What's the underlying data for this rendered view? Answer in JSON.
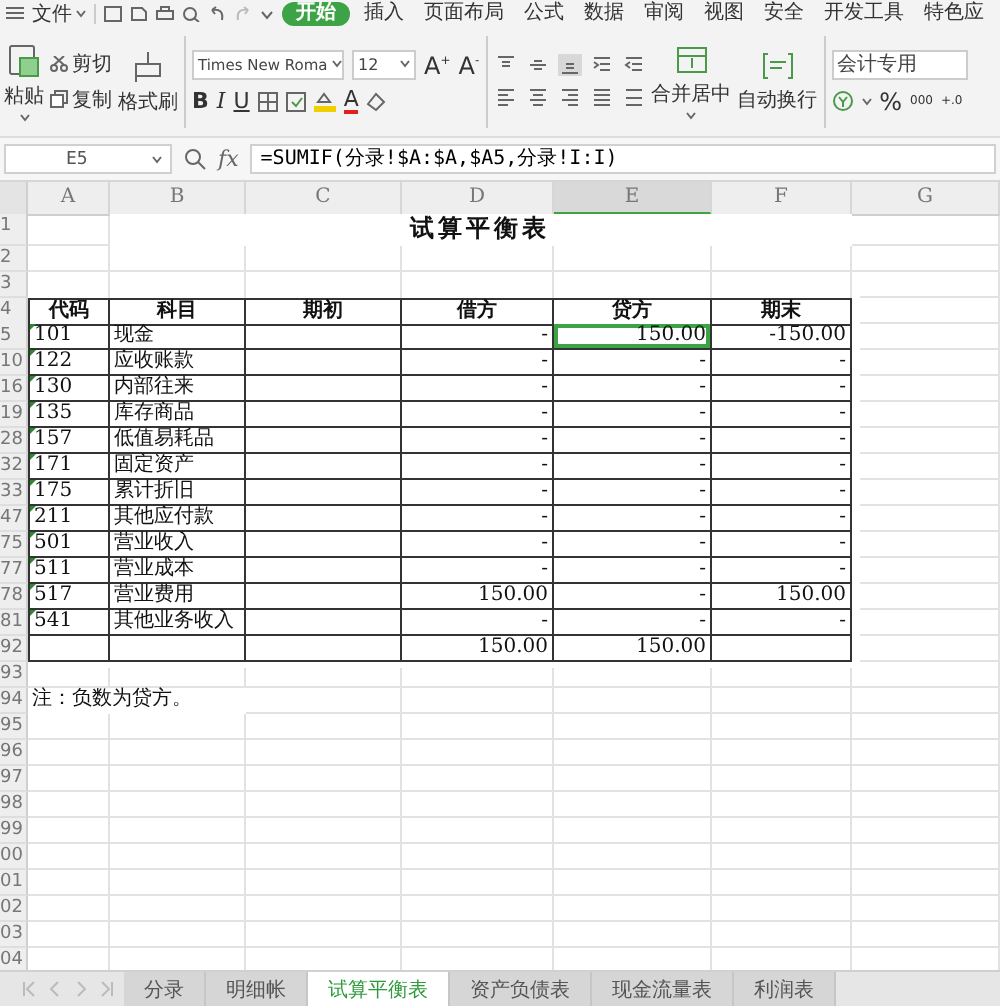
{
  "menu": {
    "file": "文件",
    "tabs": [
      {
        "label": "开始",
        "selected": true
      },
      {
        "label": "插入",
        "selected": false
      },
      {
        "label": "页面布局",
        "selected": false
      },
      {
        "label": "公式",
        "selected": false
      },
      {
        "label": "数据",
        "selected": false
      },
      {
        "label": "审阅",
        "selected": false
      },
      {
        "label": "视图",
        "selected": false
      },
      {
        "label": "安全",
        "selected": false
      },
      {
        "label": "开发工具",
        "selected": false
      },
      {
        "label": "特色应",
        "selected": false
      }
    ]
  },
  "ribbon": {
    "paste": "粘贴",
    "cut": "剪切",
    "copy": "复制",
    "format_painter": "格式刷",
    "font_name": "Times New Roma",
    "font_size": "12",
    "grow_font": "A$^{+}$",
    "shrink_font": "A$^{-}$",
    "bold": "B",
    "italic": "I",
    "underline": "U",
    "font_color": "A",
    "merge": "合并居中",
    "wrap": "自动换行",
    "number_format": "会计专用",
    "percent": "%",
    "thousands": "000",
    "add_decimal": "+.0"
  },
  "formula_bar": {
    "name_box": "E5",
    "fx": "fx",
    "formula": "=SUMIF(分录!$A:$A,$A5,分录!I:I)"
  },
  "columns": [
    {
      "label": "A",
      "selected": false
    },
    {
      "label": "B",
      "selected": false
    },
    {
      "label": "C",
      "selected": false
    },
    {
      "label": "D",
      "selected": false
    },
    {
      "label": "E",
      "selected": true
    },
    {
      "label": "F",
      "selected": false
    },
    {
      "label": "G",
      "selected": false
    }
  ],
  "rows": [
    {
      "number": "1",
      "kind": "title",
      "text": "试算平衡表"
    },
    {
      "number": "2",
      "kind": "blank"
    },
    {
      "number": "3",
      "kind": "blank"
    },
    {
      "number": "4",
      "kind": "header",
      "cells": [
        "代码",
        "科目",
        "期初",
        "借方",
        "贷方",
        "期末"
      ]
    },
    {
      "number": "5",
      "kind": "data",
      "code": "101",
      "subject": "现金",
      "debit": "-",
      "credit": "150.00",
      "ending": "-150.00",
      "flagged": true,
      "selected": true
    },
    {
      "number": "10",
      "kind": "data",
      "code": "122",
      "subject": "应收账款",
      "debit": "-",
      "credit": "-",
      "ending": "-",
      "flagged": true,
      "selected": false
    },
    {
      "number": "16",
      "kind": "data",
      "code": "130",
      "subject": "内部往来",
      "debit": "-",
      "credit": "-",
      "ending": "-",
      "flagged": true,
      "selected": false
    },
    {
      "number": "19",
      "kind": "data",
      "code": "135",
      "subject": "库存商品",
      "debit": "-",
      "credit": "-",
      "ending": "-",
      "flagged": true,
      "selected": false
    },
    {
      "number": "28",
      "kind": "data",
      "code": "157",
      "subject": "低值易耗品",
      "debit": "-",
      "credit": "-",
      "ending": "-",
      "flagged": true,
      "selected": false
    },
    {
      "number": "32",
      "kind": "data",
      "code": "171",
      "subject": "固定资产",
      "debit": "-",
      "credit": "-",
      "ending": "-",
      "flagged": true,
      "selected": false
    },
    {
      "number": "33",
      "kind": "data",
      "code": "175",
      "subject": "累计折旧",
      "debit": "-",
      "credit": "-",
      "ending": "-",
      "flagged": true,
      "selected": false
    },
    {
      "number": "47",
      "kind": "data",
      "code": "211",
      "subject": "其他应付款",
      "debit": "-",
      "credit": "-",
      "ending": "-",
      "flagged": true,
      "selected": false
    },
    {
      "number": "75",
      "kind": "data",
      "code": "501",
      "subject": "营业收入",
      "debit": "-",
      "credit": "-",
      "ending": "-",
      "flagged": true,
      "selected": false
    },
    {
      "number": "77",
      "kind": "data",
      "code": "511",
      "subject": "营业成本",
      "debit": "-",
      "credit": "-",
      "ending": "-",
      "flagged": true,
      "selected": false
    },
    {
      "number": "78",
      "kind": "data",
      "code": "517",
      "subject": "营业费用",
      "debit": "150.00",
      "credit": "-",
      "ending": "150.00",
      "flagged": true,
      "selected": false
    },
    {
      "number": "81",
      "kind": "data",
      "code": "541",
      "subject": "其他业务收入",
      "debit": "-",
      "credit": "-",
      "ending": "-",
      "flagged": true,
      "selected": false
    },
    {
      "number": "92",
      "kind": "total",
      "debit": "150.00",
      "credit": "150.00"
    },
    {
      "number": "93",
      "kind": "blank"
    },
    {
      "number": "94",
      "kind": "note",
      "text": "注：负数为贷方。"
    },
    {
      "number": "95",
      "kind": "blank"
    },
    {
      "number": "96",
      "kind": "blank"
    },
    {
      "number": "97",
      "kind": "blank"
    },
    {
      "number": "98",
      "kind": "blank"
    },
    {
      "number": "99",
      "kind": "blank"
    },
    {
      "number": "00",
      "kind": "blank"
    },
    {
      "number": "01",
      "kind": "blank"
    },
    {
      "number": "02",
      "kind": "blank"
    },
    {
      "number": "03",
      "kind": "blank"
    },
    {
      "number": "04",
      "kind": "blank"
    }
  ],
  "sheet_tabs": [
    {
      "label": "分录",
      "selected": false
    },
    {
      "label": "明细帐",
      "selected": false
    },
    {
      "label": "试算平衡表",
      "selected": true
    },
    {
      "label": "资产负债表",
      "selected": false
    },
    {
      "label": "现金流量表",
      "selected": false
    },
    {
      "label": "利润表",
      "selected": false
    }
  ]
}
